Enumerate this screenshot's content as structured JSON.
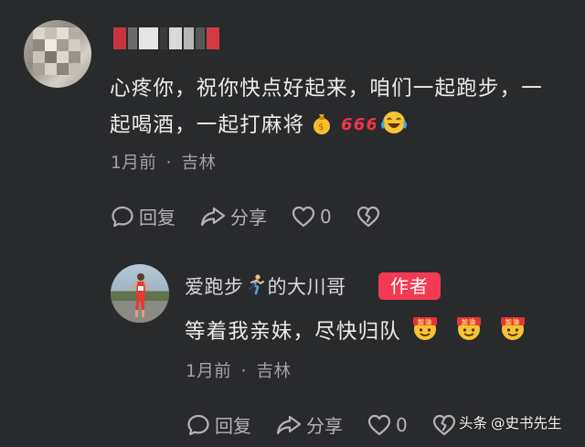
{
  "comment": {
    "username": "▖▘▀▝▖▗",
    "text": "心疼你，祝你快点好起来，咱们一起跑步，一起喝酒，一起打麻将",
    "emojis": [
      "money-bag-icon",
      "666-icon",
      "laugh-cry-icon"
    ],
    "time": "1月前",
    "location": "吉林",
    "separator": "·",
    "actions": {
      "reply_label": "回复",
      "share_label": "分享",
      "like_count": "0"
    }
  },
  "reply": {
    "username_prefix": "爱跑步",
    "username_suffix": "的大川哥",
    "author_badge": "作者",
    "text": "等着我亲妹，尽快归队",
    "emojis": [
      "fighting-icon",
      "fighting-icon",
      "fighting-icon"
    ],
    "time": "1月前",
    "location": "吉林",
    "separator": "·",
    "actions": {
      "reply_label": "回复",
      "share_label": "分享",
      "like_count": "0"
    }
  },
  "watermark": {
    "brand": "头条",
    "author": "@史书先生"
  },
  "colors": {
    "background": "#292a2c",
    "author_badge": "#f23a54",
    "meta_text": "#a3a3a6"
  }
}
